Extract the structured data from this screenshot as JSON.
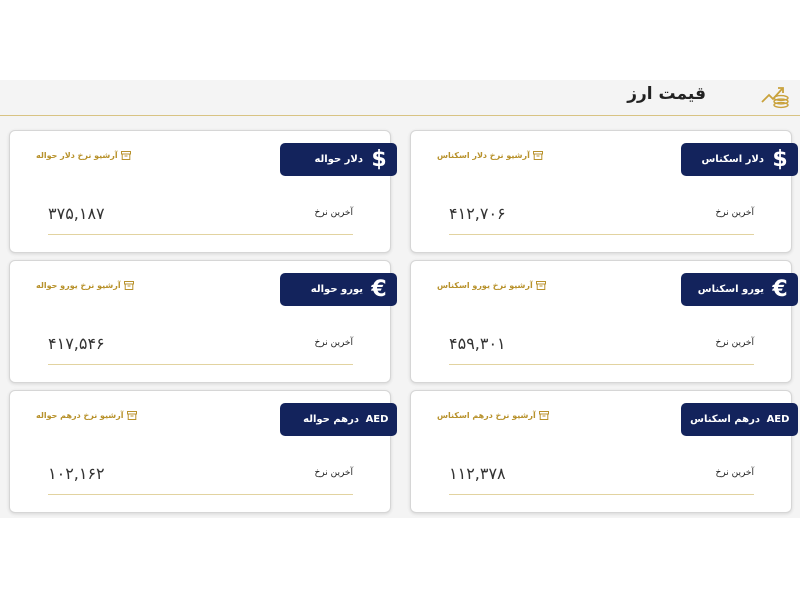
{
  "header": {
    "title": "قیمت ارز",
    "icon": "coins-chart-icon"
  },
  "colors": {
    "badge_bg": "#13235c",
    "archive_text": "#b8922c",
    "divider": "#e2d3a0"
  },
  "cards": [
    {
      "name": "dollar-transfer",
      "symbol": "$",
      "title": "دلار حواله",
      "archive_label": "آرشیو نرخ دلار حواله",
      "last_label": "آخرین نرخ",
      "price": "۳۷۵,۱۸۷"
    },
    {
      "name": "dollar-banknote",
      "symbol": "$",
      "title": "دلار اسکناس",
      "archive_label": "آرشیو نرخ دلار اسکناس",
      "last_label": "آخرین نرخ",
      "price": "۴۱۲,۷۰۶"
    },
    {
      "name": "euro-transfer",
      "symbol": "€",
      "title": "یورو حواله",
      "archive_label": "آرشیو نرخ یورو حواله",
      "last_label": "آخرین نرخ",
      "price": "۴۱۷,۵۴۶"
    },
    {
      "name": "euro-banknote",
      "symbol": "€",
      "title": "یورو اسکناس",
      "archive_label": "آرشیو نرخ یورو اسکناس",
      "last_label": "آخرین نرخ",
      "price": "۴۵۹,۳۰۱"
    },
    {
      "name": "dirham-transfer",
      "symbol": "AED",
      "title": "درهم حواله",
      "archive_label": "آرشیو نرخ درهم حواله",
      "last_label": "آخرین نرخ",
      "price": "۱۰۲,۱۶۲"
    },
    {
      "name": "dirham-banknote",
      "symbol": "AED",
      "title": "درهم اسکناس",
      "archive_label": "آرشیو نرخ درهم اسکناس",
      "last_label": "آخرین نرخ",
      "price": "۱۱۲,۳۷۸"
    }
  ]
}
